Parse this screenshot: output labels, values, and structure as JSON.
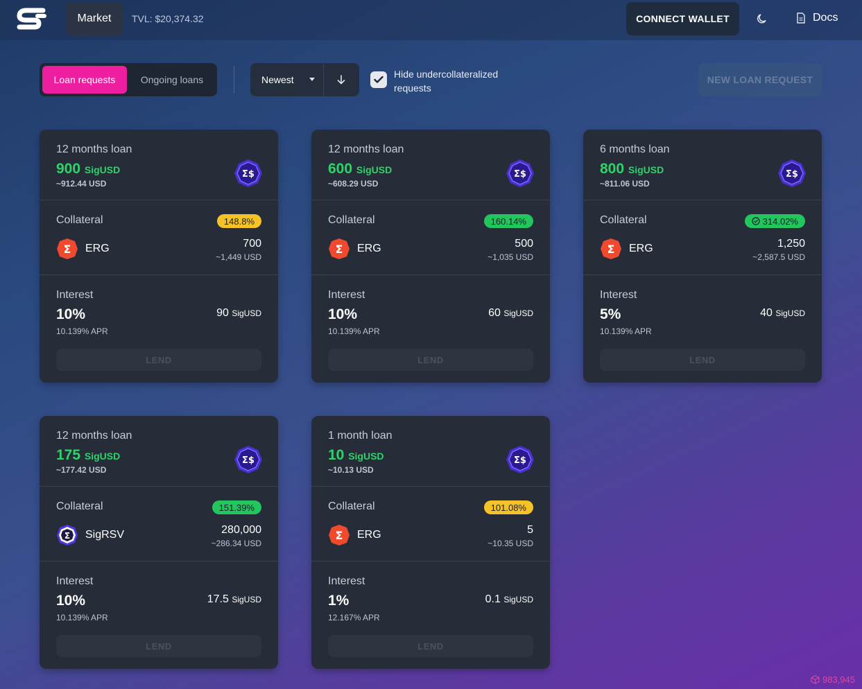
{
  "header": {
    "logo_icon": "sigmafi-logo-icon",
    "market_label": "Market",
    "tvl": "TVL: $20,374.32",
    "connect_label": "CONNECT WALLET",
    "theme_icon": "moon-icon",
    "docs_label": "Docs",
    "docs_icon": "document-icon"
  },
  "toolbar": {
    "tabs": [
      {
        "label": "Loan requests",
        "active": true
      },
      {
        "label": "Ongoing loans",
        "active": false
      }
    ],
    "sort_label": "Newest",
    "sort_direction_icon": "arrow-down-icon",
    "hide_label": "Hide undercollateralized requests",
    "hide_checked": true,
    "new_loan_label": "NEW LOAN REQUEST"
  },
  "labels": {
    "collateral": "Collateral",
    "interest": "Interest",
    "lend": "LEND"
  },
  "colors": {
    "accent": "#ee1ea0",
    "positive": "#2fd36a",
    "warning": "#f5c227",
    "ok": "#22c55e"
  },
  "cards": [
    {
      "term": "12 months loan",
      "amount": "900",
      "token": "SigUSD",
      "amount_usd": "~912.44 USD",
      "ratio": "148.8%",
      "ratio_color": "yellow",
      "ratio_check": false,
      "coll_asset": "ERG",
      "coll_amount": "700",
      "coll_usd": "~1,449 USD",
      "interest_pct": "10%",
      "apr": "10.139% APR",
      "interest_amount": "90",
      "interest_token": "SigUSD"
    },
    {
      "term": "12 months loan",
      "amount": "600",
      "token": "SigUSD",
      "amount_usd": "~608.29 USD",
      "ratio": "160.14%",
      "ratio_color": "green",
      "ratio_check": false,
      "coll_asset": "ERG",
      "coll_amount": "500",
      "coll_usd": "~1,035 USD",
      "interest_pct": "10%",
      "apr": "10.139% APR",
      "interest_amount": "60",
      "interest_token": "SigUSD"
    },
    {
      "term": "6 months loan",
      "amount": "800",
      "token": "SigUSD",
      "amount_usd": "~811.06 USD",
      "ratio": "314.02%",
      "ratio_color": "green",
      "ratio_check": true,
      "coll_asset": "ERG",
      "coll_amount": "1,250",
      "coll_usd": "~2,587.5 USD",
      "interest_pct": "5%",
      "apr": "10.139% APR",
      "interest_amount": "40",
      "interest_token": "SigUSD"
    },
    {
      "term": "12 months loan",
      "amount": "175",
      "token": "SigUSD",
      "amount_usd": "~177.42 USD",
      "ratio": "151.39%",
      "ratio_color": "green",
      "ratio_check": false,
      "coll_asset": "SigRSV",
      "coll_amount": "280,000",
      "coll_usd": "~286.34 USD",
      "interest_pct": "10%",
      "apr": "10.139% APR",
      "interest_amount": "17.5",
      "interest_token": "SigUSD"
    },
    {
      "term": "1 month loan",
      "amount": "10",
      "token": "SigUSD",
      "amount_usd": "~10.13 USD",
      "ratio": "101.08%",
      "ratio_color": "yellow",
      "ratio_check": false,
      "coll_asset": "ERG",
      "coll_amount": "5",
      "coll_usd": "~10.35 USD",
      "interest_pct": "1%",
      "apr": "12.167% APR",
      "interest_amount": "0.1",
      "interest_token": "SigUSD"
    }
  ],
  "footer": {
    "block_icon": "cube-icon",
    "block_height": "983,945"
  }
}
